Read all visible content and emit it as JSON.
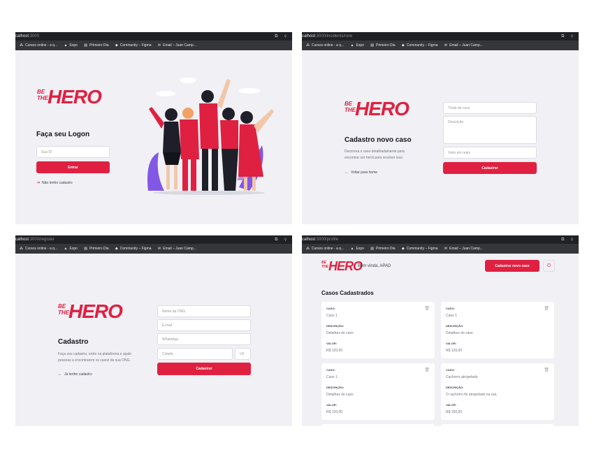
{
  "browser": {
    "bookmarks": [
      "Cursos online - a q...",
      "Expo",
      "Primeiro Dia",
      "Community – Figma",
      "Email – Juan Camp..."
    ]
  },
  "logo": {
    "be": "BE",
    "the": "THE",
    "hero": "HERO"
  },
  "logon": {
    "url_host": "calhost",
    "url_rest": ":3000",
    "title": "Faça seu Logon",
    "id_placeholder": "Sua ID",
    "submit": "Entrar",
    "register_link": "Não tenho cadastro"
  },
  "new_incident": {
    "url_host": "calhost",
    "url_rest": ":3000/incidents/new",
    "title": "Cadastro novo caso",
    "description": "Descreva o caso detalhadamente para encontrar um herói para resolver isso.",
    "back_link": "Voltar para home",
    "title_placeholder": "Título do caso",
    "desc_placeholder": "Descrição",
    "value_placeholder": "Valor em reais",
    "submit": "Cadastrar"
  },
  "register": {
    "url_host": "calhost",
    "url_rest": ":3000/register",
    "title": "Cadastro",
    "description": "Faça seu cadastro, entre na plataforma e ajude pessoas a encontrarem os casos da sua ONG.",
    "back_link": "Já tenho cadastro",
    "name_placeholder": "Nome da ONG",
    "email_placeholder": "E-mail",
    "whatsapp_placeholder": "WhatsApp",
    "city_placeholder": "Cidade",
    "uf_placeholder": "UF",
    "submit": "Cadastrar"
  },
  "profile": {
    "url_host": "calhost",
    "url_rest": ":3000/profile",
    "welcome": "Bem vinda, APAD",
    "new_case_button": "Cadastrar novo caso",
    "heading": "Casos Cadastrados",
    "labels": {
      "case": "CASO:",
      "description": "DESCRIÇÃO:",
      "value": "VALOR:"
    },
    "cases": [
      {
        "case": "Caso 1",
        "description": "Detalhes do caso",
        "value": "R$ 120,00"
      },
      {
        "case": "Caso 1",
        "description": "Detalhes do caso",
        "value": "R$ 120,00"
      },
      {
        "case": "Caso 1",
        "description": "Detalhes do caso",
        "value": "R$ 120,00"
      },
      {
        "case": "Cachorro atropelado",
        "description": "O cachorro foi atropelado na rua.",
        "value": "R$ 150,00"
      }
    ]
  },
  "colors": {
    "accent": "#e02041",
    "background": "#f0f0f5",
    "text": "#13131a"
  }
}
